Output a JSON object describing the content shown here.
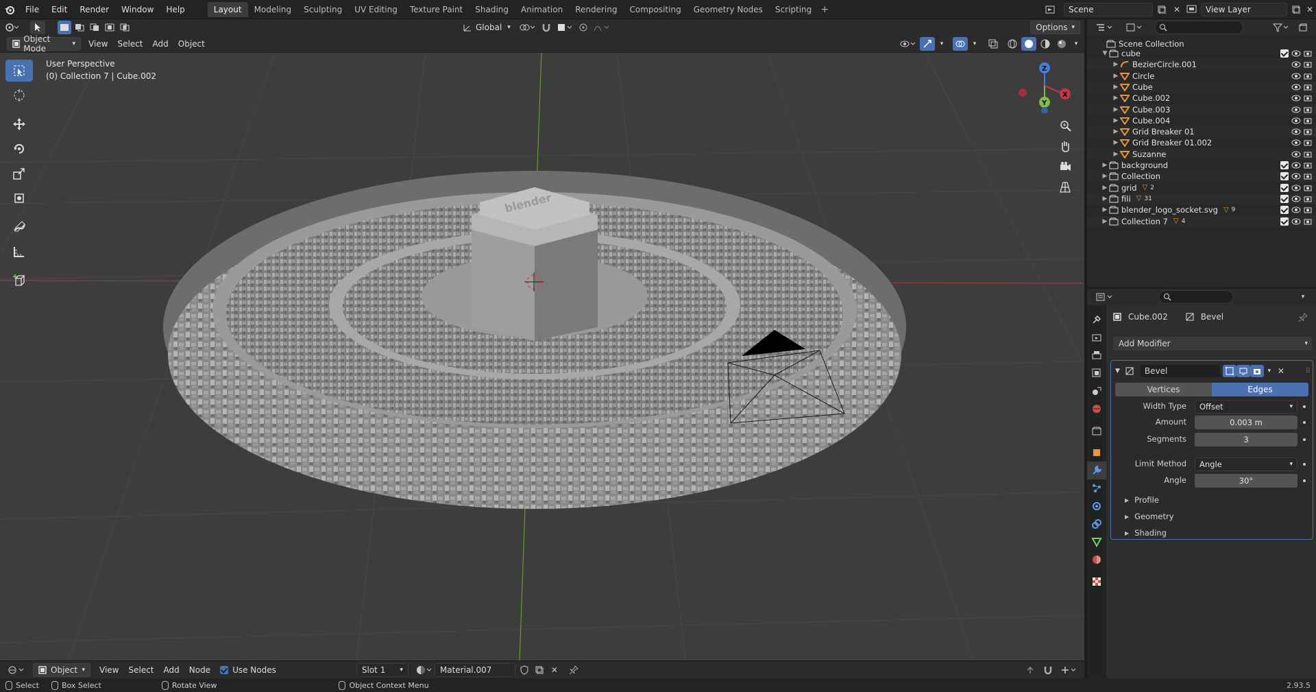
{
  "menus": [
    "File",
    "Edit",
    "Render",
    "Window",
    "Help"
  ],
  "workspaces": [
    "Layout",
    "Modeling",
    "Sculpting",
    "UV Editing",
    "Texture Paint",
    "Shading",
    "Animation",
    "Rendering",
    "Compositing",
    "Geometry Nodes",
    "Scripting"
  ],
  "active_workspace": "Layout",
  "scene": "Scene",
  "view_layer": "View Layer",
  "viewport_header": {
    "transform_orientation": "Global",
    "options": "Options",
    "mode": "Object Mode",
    "menus": [
      "View",
      "Select",
      "Add",
      "Object"
    ]
  },
  "viewport": {
    "perspective": "User Perspective",
    "info": "(0) Collection 7 | Cube.002",
    "gizmo": {
      "z": "Z",
      "x": "X",
      "y": "Y"
    }
  },
  "outliner": {
    "root": "Scene Collection",
    "rows": [
      {
        "label": "cube",
        "type": "collection",
        "depth": 1,
        "expanded": true
      },
      {
        "label": "BezierCircle.001",
        "type": "curve",
        "depth": 2
      },
      {
        "label": "Circle",
        "type": "mesh",
        "depth": 2
      },
      {
        "label": "Cube",
        "type": "mesh",
        "depth": 2
      },
      {
        "label": "Cube.002",
        "type": "mesh",
        "depth": 2
      },
      {
        "label": "Cube.003",
        "type": "mesh",
        "depth": 2
      },
      {
        "label": "Cube.004",
        "type": "mesh",
        "depth": 2
      },
      {
        "label": "Grid Breaker 01",
        "type": "mesh",
        "depth": 2
      },
      {
        "label": "Grid Breaker 01.002",
        "type": "mesh",
        "depth": 2
      },
      {
        "label": "Suzanne",
        "type": "mesh",
        "depth": 2
      },
      {
        "label": "background",
        "type": "collection",
        "depth": 1
      },
      {
        "label": "Collection",
        "type": "collection",
        "depth": 1
      },
      {
        "label": "grid",
        "type": "collection",
        "depth": 1,
        "badge": "2"
      },
      {
        "label": "fili",
        "type": "collection",
        "depth": 1,
        "badge": "31"
      },
      {
        "label": "blender_logo_socket.svg",
        "type": "collection",
        "depth": 1,
        "badge": "9"
      },
      {
        "label": "Collection 7",
        "type": "collection",
        "depth": 1,
        "badge": "4"
      }
    ]
  },
  "properties": {
    "object": "Cube.002",
    "modifier_context": "Bevel",
    "add_modifier": "Add Modifier",
    "modifier_name": "Bevel",
    "affect_vertices": "Vertices",
    "affect_edges": "Edges",
    "width_type_label": "Width Type",
    "width_type": "Offset",
    "amount_label": "Amount",
    "amount": "0.003 m",
    "segments_label": "Segments",
    "segments": "3",
    "limit_method_label": "Limit Method",
    "limit_method": "Angle",
    "angle_label": "Angle",
    "angle": "30°",
    "subpanels": [
      "Profile",
      "Geometry",
      "Shading"
    ]
  },
  "node_header": {
    "editor": "Object",
    "menus": [
      "View",
      "Select",
      "Add",
      "Node"
    ],
    "use_nodes": "Use Nodes",
    "slot": "Slot 1",
    "material": "Material.007"
  },
  "statusbar": {
    "select": "Select",
    "box_select": "Box Select",
    "rotate_view": "Rotate View",
    "context_menu": "Object Context Menu",
    "version": "2.93.5"
  },
  "colors": {
    "accent": "#4a72b3",
    "x_axis": "#cc3344",
    "y_axis": "#7fbf3f",
    "z_axis": "#3f7fdf"
  }
}
